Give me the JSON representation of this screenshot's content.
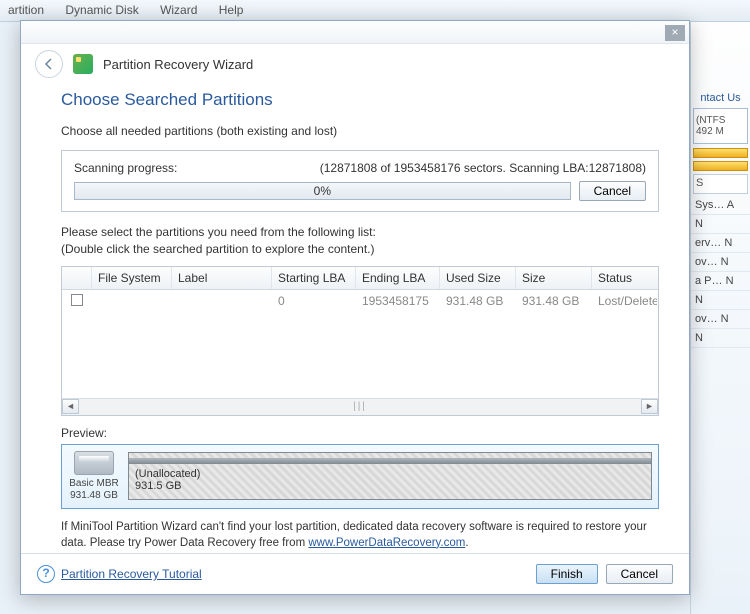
{
  "bg_menu": {
    "items": [
      "artition",
      "Dynamic Disk",
      "Wizard",
      "Help"
    ]
  },
  "bg_right": {
    "contact": "ntact Us",
    "ntfs": "(NTFS",
    "ntfs2": "492 M",
    "cols": "S",
    "rows": [
      "Sys…  A",
      "N",
      "erv…  N",
      "ov…  N",
      "a P…  N",
      "N",
      "ov…  N",
      "N"
    ]
  },
  "wizard_title": "Partition Recovery Wizard",
  "heading": "Choose Searched Partitions",
  "subtitle": "Choose all needed partitions (both existing and lost)",
  "scan": {
    "label": "Scanning progress:",
    "status": "(12871808 of 1953458176 sectors. Scanning LBA:12871808)",
    "percent": "0%",
    "cancel": "Cancel"
  },
  "instructions": {
    "line1": "Please select the partitions you need from the following list:",
    "line2": "(Double click the searched partition to explore the content.)"
  },
  "table": {
    "headers": {
      "fs": "File System",
      "label": "Label",
      "slba": "Starting LBA",
      "elba": "Ending LBA",
      "used": "Used Size",
      "size": "Size",
      "status": "Status"
    },
    "rows": [
      {
        "fs": "",
        "label": "",
        "slba": "0",
        "elba": "1953458175",
        "used": "931.48 GB",
        "size": "931.48 GB",
        "status": "Lost/Deleted"
      }
    ]
  },
  "preview": {
    "label": "Preview:",
    "disk_type": "Basic MBR",
    "disk_size": "931.48 GB",
    "part_name": "(Unallocated)",
    "part_size": "931.5 GB"
  },
  "tip": {
    "text1": "If MiniTool Partition Wizard can't find your lost partition, dedicated data recovery software is required to restore your data. Please try Power Data Recovery free from ",
    "link": "www.PowerDataRecovery.com",
    "text2": "."
  },
  "footer": {
    "tutorial": "Partition Recovery Tutorial",
    "finish": "Finish",
    "cancel": "Cancel"
  }
}
